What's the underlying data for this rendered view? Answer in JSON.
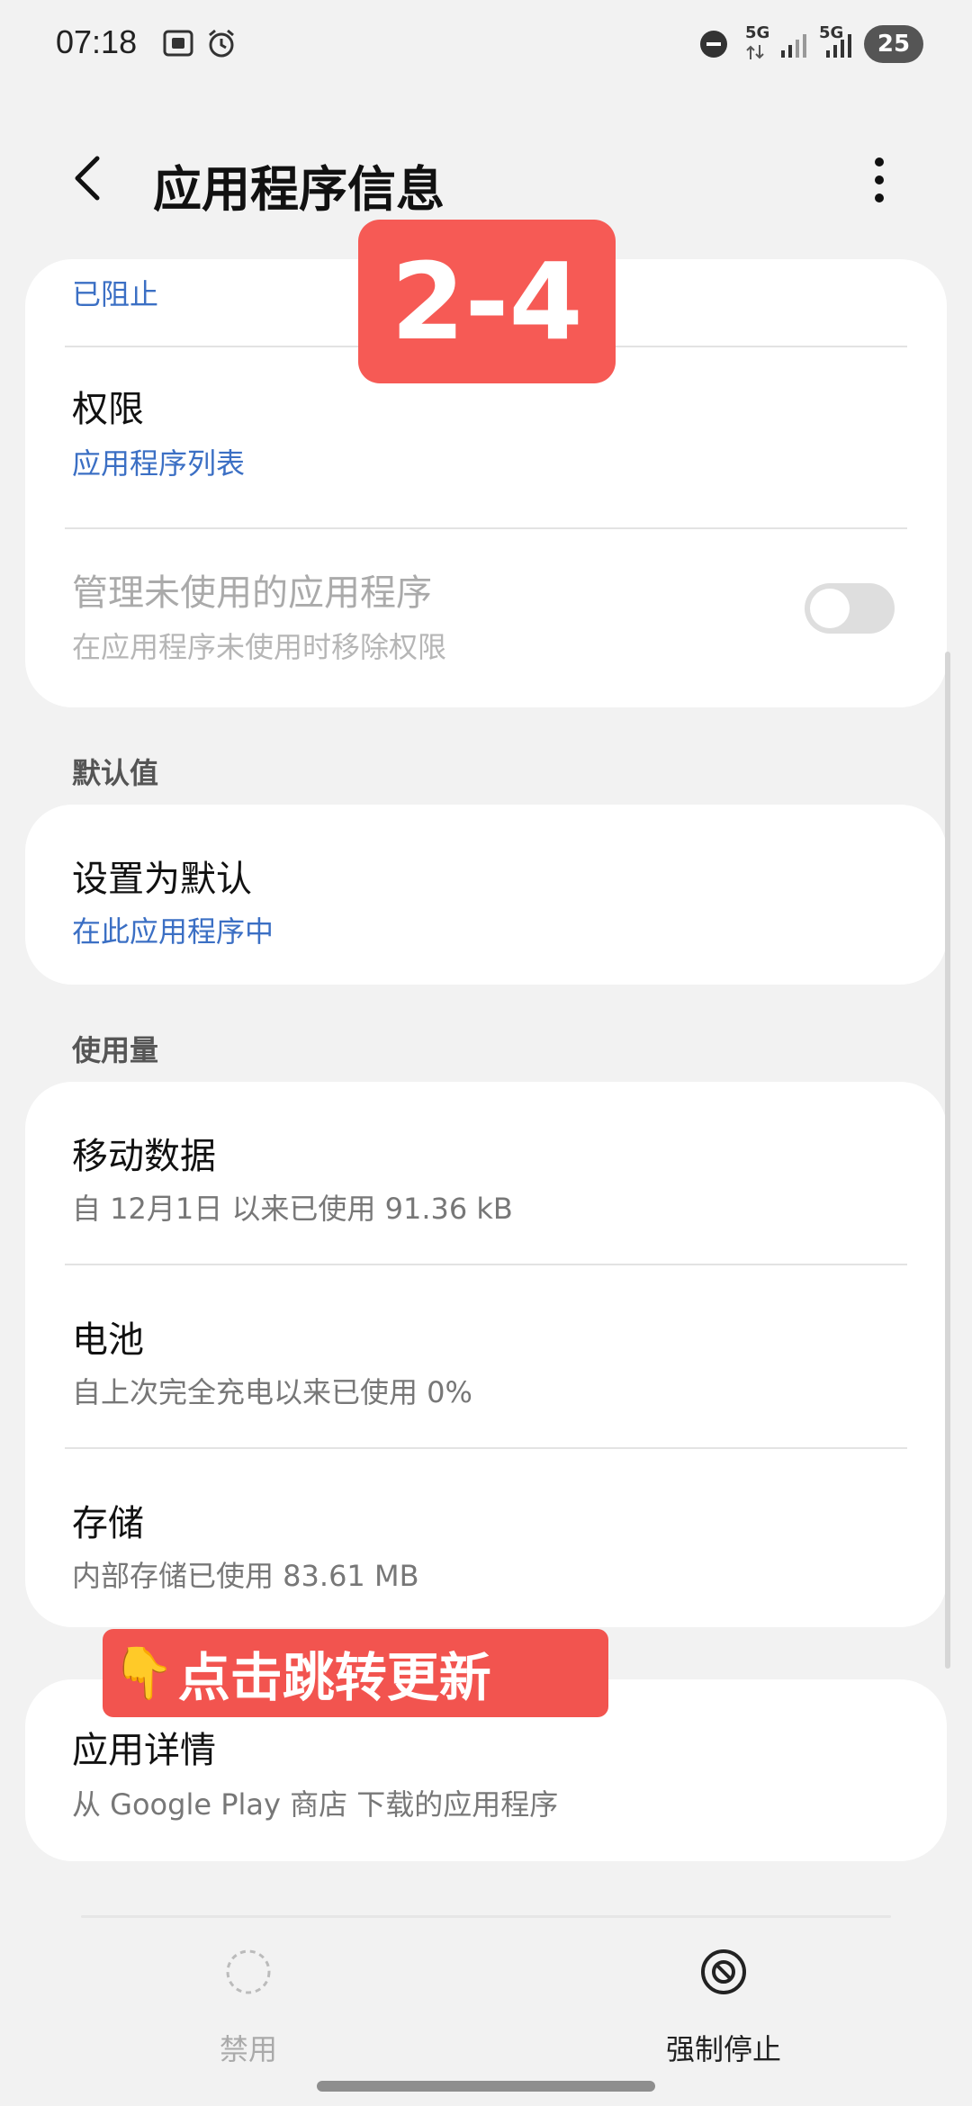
{
  "status_bar": {
    "time": "07:18",
    "net1": "5G",
    "net2": "5G",
    "battery": "25"
  },
  "header": {
    "title": "应用程序信息"
  },
  "overlay": {
    "badge": "2-4",
    "tap_hint": "点击跳转更新"
  },
  "notifications_card": {
    "blocked_sub": "已阻止",
    "permissions": {
      "title": "权限",
      "sub": "应用程序列表"
    },
    "manage_unused": {
      "title": "管理未使用的应用程序",
      "sub": "在应用程序未使用时移除权限",
      "toggle_on": false
    }
  },
  "defaults": {
    "section": "默认值",
    "set_default": {
      "title": "设置为默认",
      "sub": "在此应用程序中"
    }
  },
  "usage": {
    "section": "使用量",
    "mobile_data": {
      "title": "移动数据",
      "sub": "自 12月1日 以来已使用 91.36 kB"
    },
    "battery": {
      "title": "电池",
      "sub": "自上次完全充电以来已使用 0%"
    },
    "storage": {
      "title": "存储",
      "sub": "内部存储已使用 83.61 MB"
    }
  },
  "app_details": {
    "title": "应用详情",
    "sub": "从 Google Play 商店 下载的应用程序"
  },
  "bottom_bar": {
    "disable_label": "禁用",
    "force_stop_label": "强制停止"
  }
}
